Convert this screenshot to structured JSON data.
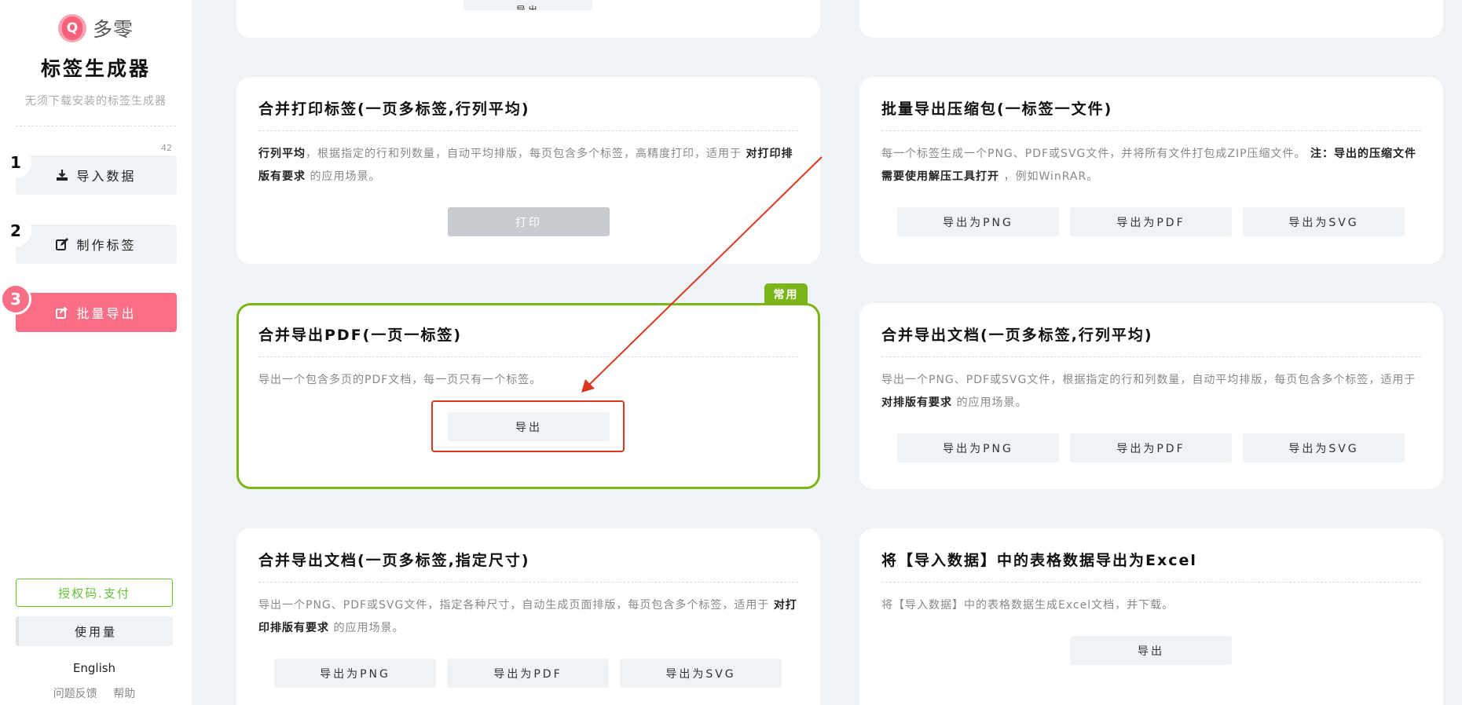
{
  "sidebar": {
    "logo_letter": "Q",
    "logo_text": "多零",
    "app_title": "标签生成器",
    "app_subtitle": "无须下载安装的标签生成器",
    "count": "42",
    "steps": [
      {
        "num": "1",
        "label": "导入数据",
        "icon": "download-icon"
      },
      {
        "num": "2",
        "label": "制作标签",
        "icon": "edit-icon"
      },
      {
        "num": "3",
        "label": "批量导出",
        "icon": "share-icon",
        "active": true
      }
    ],
    "license_label": "授权码.支付",
    "usage_label": "使用量",
    "language_label": "English",
    "feedback_label": "问题反馈",
    "help_label": "帮助"
  },
  "top_partial": {
    "button_label": "导出"
  },
  "cards": {
    "print": {
      "title": "合并打印标签(一页多标签,行列平均)",
      "desc_b1": "行列平均",
      "desc_t1": "，根据指定的行和列数量，自动平均排版，每页包含多个标签，高精度打印，适用于",
      "desc_b2": "对打印排版有要求",
      "desc_t2": "的应用场景。",
      "button": "打印"
    },
    "zip": {
      "title": "批量导出压缩包(一标签一文件)",
      "desc_t1": "每一个标签生成一个PNG、PDF或SVG文件，并将所有文件打包成ZIP压缩文件。",
      "desc_b1": "注：导出的压缩文件需要使用解压工具打开",
      "desc_t2": "，例如WinRAR。",
      "buttons": [
        "导出为PNG",
        "导出为PDF",
        "导出为SVG"
      ]
    },
    "pdf": {
      "tag": "常用",
      "title": "合并导出PDF(一页一标签)",
      "desc": "导出一个包含多页的PDF文档，每一页只有一个标签。",
      "button": "导出"
    },
    "doc_avg": {
      "title": "合并导出文档(一页多标签,行列平均)",
      "desc_t1": "导出一个PNG、PDF或SVG文件，根据指定的行和列数量，自动平均排版，每页包含多个标签，适用于",
      "desc_b1": "对排版有要求",
      "desc_t2": "的应用场景。",
      "buttons": [
        "导出为PNG",
        "导出为PDF",
        "导出为SVG"
      ]
    },
    "doc_size": {
      "title": "合并导出文档(一页多标签,指定尺寸)",
      "desc_t1": "导出一个PNG、PDF或SVG文件，指定各种尺寸，自动生成页面排版，每页包含多个标签，适用于",
      "desc_b1": "对打印排版有要求",
      "desc_t2": "的应用场景。",
      "buttons": [
        "导出为PNG",
        "导出为PDF",
        "导出为SVG"
      ]
    },
    "excel": {
      "title": "将【导入数据】中的表格数据导出为Excel",
      "desc": "将【导入数据】中的表格数据生成Excel文档，并下载。",
      "button": "导出"
    }
  },
  "colors": {
    "accent_pink": "#fa6e86",
    "accent_green": "#7cb518",
    "annotation_red": "#d9381e"
  }
}
